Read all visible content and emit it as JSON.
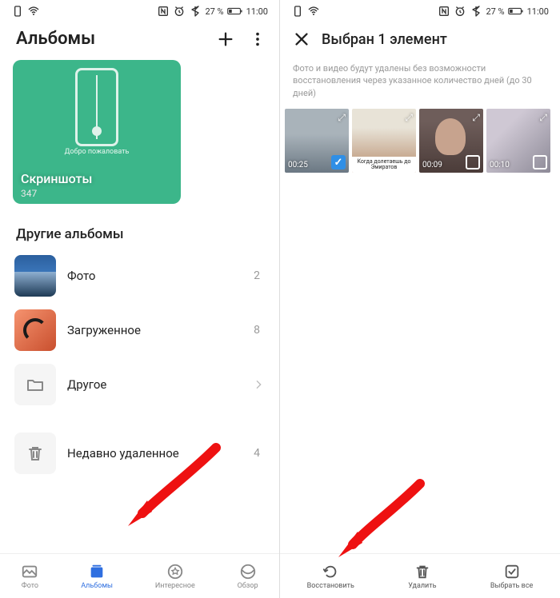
{
  "status": {
    "battery_text": "27 %",
    "time": "11:00"
  },
  "left": {
    "header_title": "Альбомы",
    "featured": {
      "welcome": "Добро пожаловать",
      "label": "Скриншоты",
      "count": "347"
    },
    "section_title": "Другие альбомы",
    "albums": [
      {
        "label": "Фото",
        "count": "2"
      },
      {
        "label": "Загруженное",
        "count": "8"
      },
      {
        "label": "Другое",
        "count": ""
      },
      {
        "label": "Недавно удаленное",
        "count": "4"
      }
    ],
    "nav": {
      "photo": "Фото",
      "albums": "Альбомы",
      "interesting": "Интересное",
      "overview": "Обзор"
    }
  },
  "right": {
    "header_title": "Выбран 1 элемент",
    "deletion_note": "Фото и видео будут удалены без возможности восстановления через указанное количество дней (до 30 дней)",
    "thumbs": [
      {
        "duration": "00:25",
        "selected": true,
        "caption": ""
      },
      {
        "duration": "",
        "selected": false,
        "caption": "Когда долетаешь до Эмиратов"
      },
      {
        "duration": "00:09",
        "selected": false,
        "caption": ""
      },
      {
        "duration": "00:10",
        "selected": false,
        "caption": ""
      }
    ],
    "actions": {
      "restore": "Восстановить",
      "delete": "Удалить",
      "select_all": "Выбрать все"
    }
  }
}
